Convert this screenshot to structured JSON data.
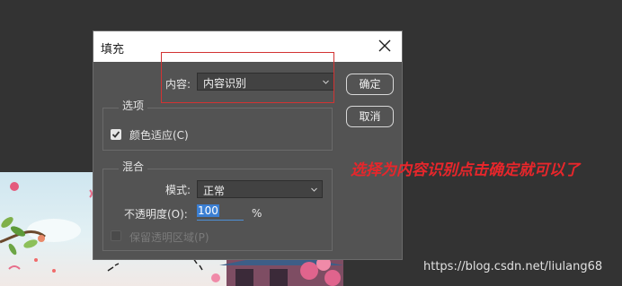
{
  "dialog": {
    "title": "填充",
    "content_label": "内容:",
    "content_value": "内容识别",
    "ok_label": "确定",
    "cancel_label": "取消",
    "options_group_title": "选项",
    "color_adapt_label": "颜色适应(C)",
    "color_adapt_checked": true,
    "blend_group_title": "混合",
    "mode_label": "模式:",
    "mode_value": "正常",
    "opacity_label": "不透明度(O):",
    "opacity_value": "100",
    "opacity_unit": "%",
    "preserve_transparency_label": "保留透明区域(P)",
    "preserve_transparency_checked": false
  },
  "annotation": {
    "text": "选择为内容识别点击确定就可以了"
  },
  "watermark": "https://blog.csdn.net/liulang68",
  "colors": {
    "background": "#333333",
    "dialog": "#535353",
    "highlight_box": "#d23333",
    "annotation": "#e8262b",
    "input_selection": "#3b7fd3"
  }
}
